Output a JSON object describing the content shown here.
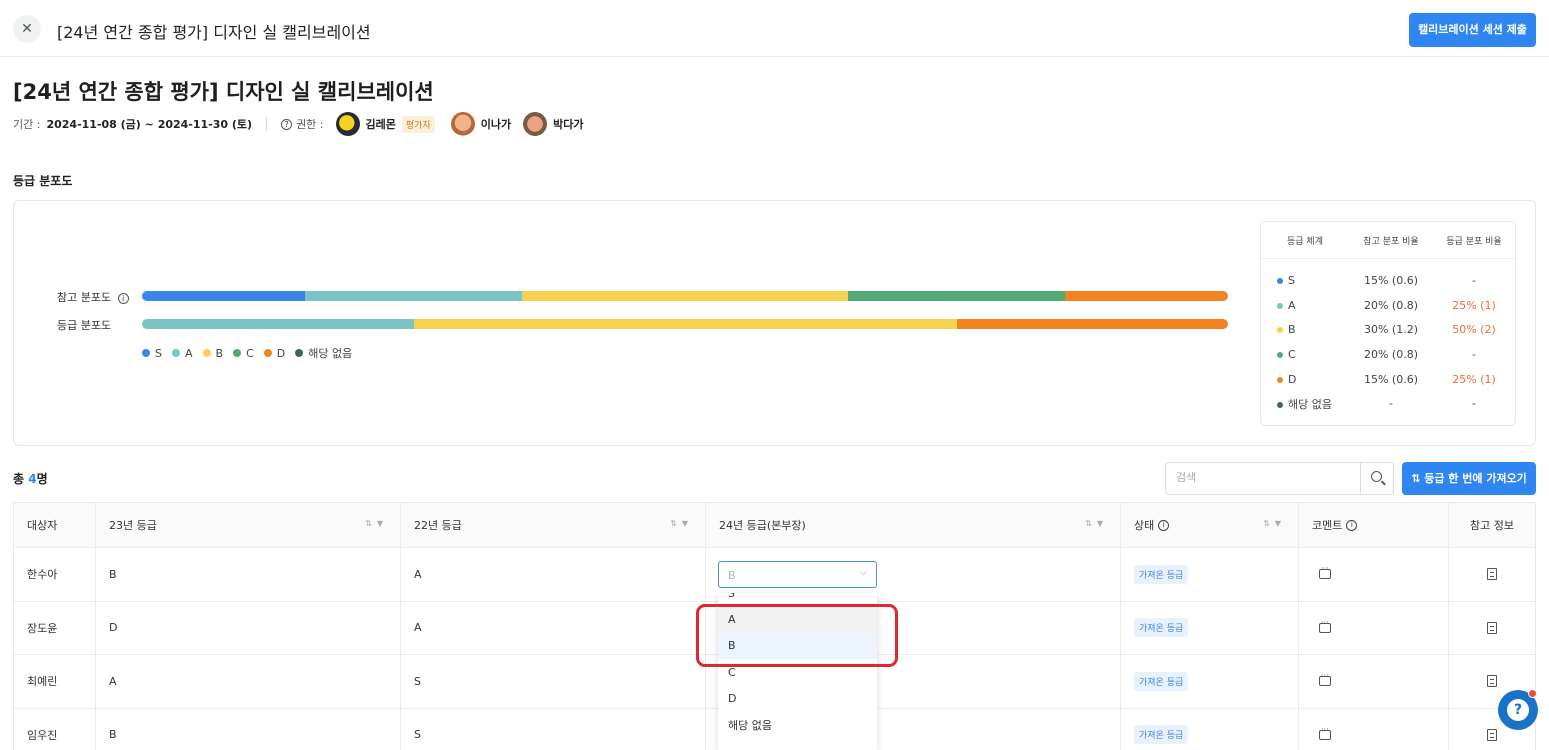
{
  "header": {
    "close_icon": "close-icon",
    "title": "[24년 연간 종합 평가] 디자인 실 캘리브레이션",
    "submit_label": "캘리브레이션 세션 제출"
  },
  "page": {
    "title": "[24년 연간 종합 평가] 디자인 실 캘리브레이션",
    "period_label": "기간 :",
    "period_value": "2024-11-08 (금) ~ 2024-11-30 (토)",
    "permission_label": "권한 :",
    "people": [
      {
        "name": "김레몬",
        "badge": "평가자"
      },
      {
        "name": "이나가"
      },
      {
        "name": "박다가"
      }
    ]
  },
  "distribution": {
    "section_title": "등급 분포도",
    "ref_label": "참고 분포도",
    "grade_label": "등급 분포도",
    "legend": [
      "S",
      "A",
      "B",
      "C",
      "D",
      "해당 없음"
    ],
    "colors": {
      "S": "#3a86e8",
      "A": "#7cc3c6",
      "B": "#f7d251",
      "C": "#52ab74",
      "D": "#f28323",
      "해당 없음": "#3e6655"
    },
    "ref_fractions": {
      "S": 0.15,
      "A": 0.2,
      "B": 0.3,
      "C": 0.2,
      "D": 0.15
    },
    "grade_fractions": {
      "A": 0.25,
      "B": 0.5,
      "D": 0.25
    }
  },
  "grade_table": {
    "headers": [
      "등급 체계",
      "참고 분포 비율",
      "등급 분포 비율"
    ],
    "rows": [
      {
        "grade": "S",
        "ref": "15% (0.6)",
        "actual": "-"
      },
      {
        "grade": "A",
        "ref": "20% (0.8)",
        "actual": "25% (1)"
      },
      {
        "grade": "B",
        "ref": "30% (1.2)",
        "actual": "50% (2)"
      },
      {
        "grade": "C",
        "ref": "20% (0.8)",
        "actual": "-"
      },
      {
        "grade": "D",
        "ref": "15% (0.6)",
        "actual": "25% (1)"
      },
      {
        "grade": "해당 없음",
        "ref": "-",
        "actual": "-"
      }
    ]
  },
  "list": {
    "total_prefix": "총",
    "total_count": "4",
    "total_suffix": "명",
    "search_placeholder": "검색",
    "fetch_label": "⇅ 등급 한 번에 가져오기",
    "headers": [
      "대상자",
      "23년 등급",
      "22년 등급",
      "24년 등급(본부장)",
      "상태",
      "코멘트",
      "참고 정보"
    ],
    "rows": [
      {
        "name": "한수아",
        "g23": "B",
        "g22": "A",
        "status": "가져온 등급"
      },
      {
        "name": "장도윤",
        "g23": "D",
        "g22": "A",
        "status": "가져온 등급"
      },
      {
        "name": "최예린",
        "g23": "A",
        "g22": "S",
        "status": "가져온 등급"
      },
      {
        "name": "임우진",
        "g23": "B",
        "g22": "S",
        "status": "가져온 등급"
      }
    ]
  },
  "select": {
    "value": "B",
    "options": [
      "S",
      "A",
      "B",
      "C",
      "D",
      "해당 없음"
    ]
  }
}
